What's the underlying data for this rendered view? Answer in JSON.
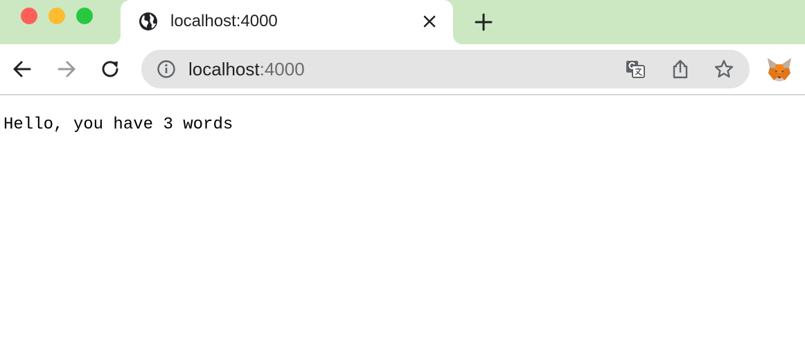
{
  "browser": {
    "tab": {
      "title": "localhost:4000",
      "favicon": "globe-icon"
    },
    "address_bar": {
      "host": "localhost",
      "port": ":4000"
    },
    "colors": {
      "tabstrip_bg": "#cce8c3",
      "close": "#fe5f57",
      "minimize": "#febc2e",
      "maximize": "#28c840"
    },
    "icons": [
      "back-arrow-icon",
      "forward-arrow-icon",
      "reload-icon",
      "info-icon",
      "translate-icon",
      "share-icon",
      "star-icon",
      "metamask-fox-icon",
      "close-icon",
      "plus-icon"
    ]
  },
  "page": {
    "text": "Hello, you have 3 words"
  }
}
